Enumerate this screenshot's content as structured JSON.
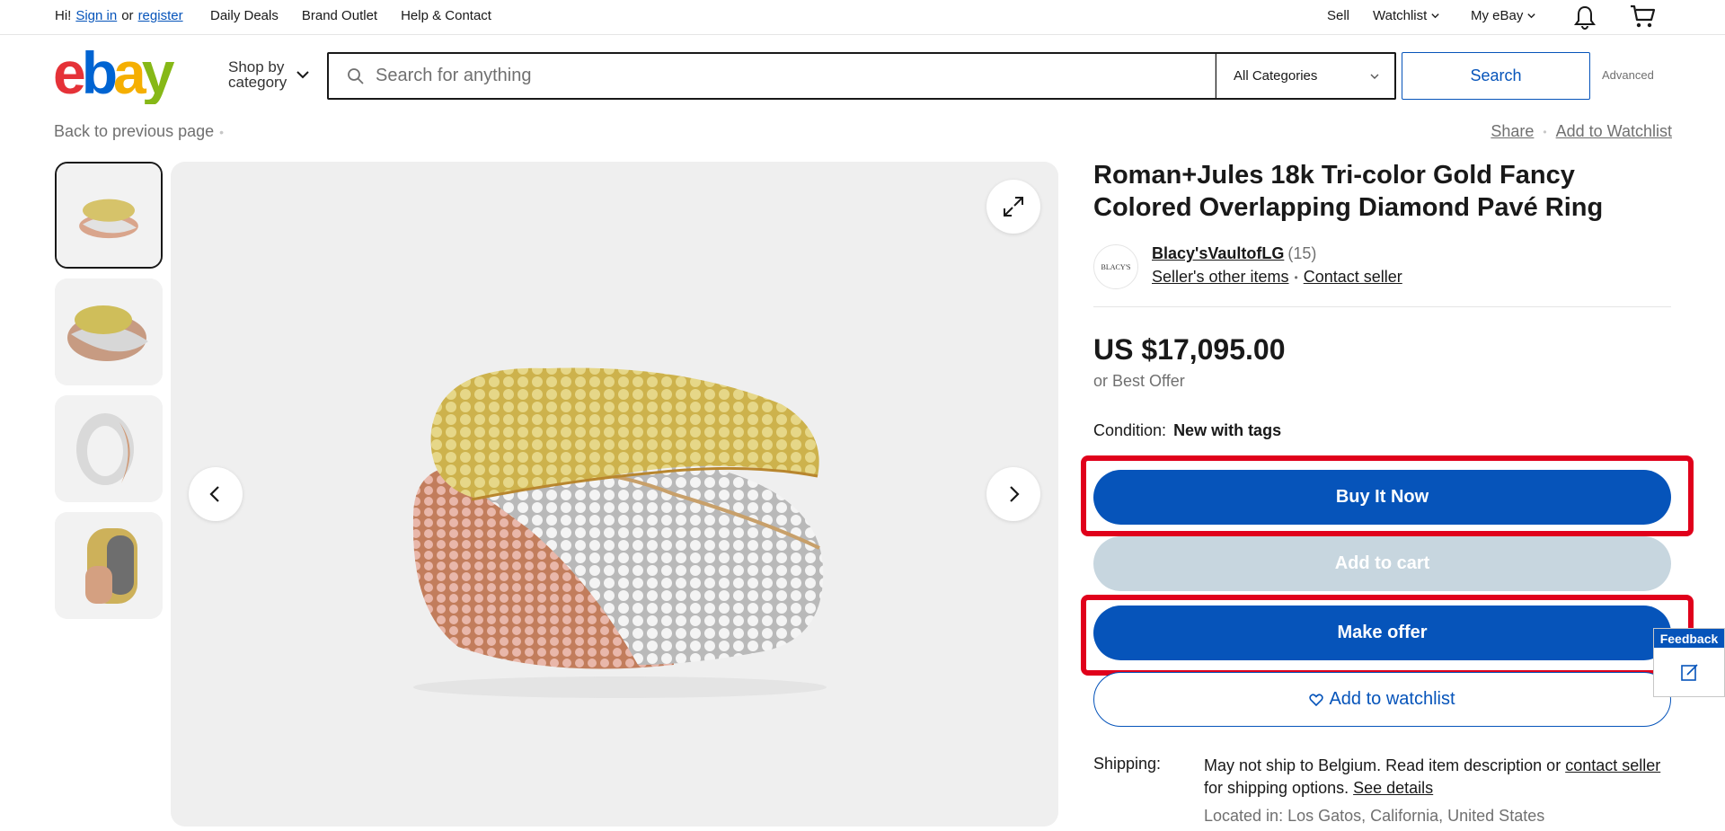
{
  "topbar": {
    "greeting": "Hi!",
    "sign_in": "Sign in",
    "or": "or",
    "register": "register",
    "links": [
      "Daily Deals",
      "Brand Outlet",
      "Help & Contact"
    ],
    "sell": "Sell",
    "watchlist": "Watchlist",
    "my_ebay": "My eBay"
  },
  "header": {
    "shop_by_line1": "Shop by",
    "shop_by_line2": "category",
    "search_placeholder": "Search for anything",
    "category": "All Categories",
    "search_button": "Search",
    "advanced": "Advanced"
  },
  "nav": {
    "back": "Back to previous page",
    "share": "Share",
    "add_watchlist": "Add to Watchlist"
  },
  "item": {
    "title": "Roman+Jules 18k Tri-color Gold Fancy Colored Overlapping Diamond Pavé Ring",
    "seller_name": "Blacy'sVaultofLG",
    "seller_feedback": "(15)",
    "seller_other_items": "Seller's other items",
    "contact_seller": "Contact seller",
    "avatar_text": "BLACY'S",
    "price": "US $17,095.00",
    "best_offer": "or Best Offer",
    "condition_label": "Condition:",
    "condition_value": "New with tags",
    "buy_now": "Buy It Now",
    "add_to_cart": "Add to cart",
    "make_offer": "Make offer",
    "add_to_watchlist": "Add to watchlist",
    "shipping_label": "Shipping:",
    "shipping_text_1": "May not ship to Belgium. Read item description or ",
    "shipping_contact": "contact seller",
    "shipping_text_2": " for shipping options. ",
    "see_details": "See details",
    "located": "Located in: Los Gatos, California, United States"
  },
  "feedback_tab": "Feedback",
  "colors": {
    "primary": "#0654ba",
    "disabled": "#c7d6df",
    "highlight": "#e0001b"
  }
}
